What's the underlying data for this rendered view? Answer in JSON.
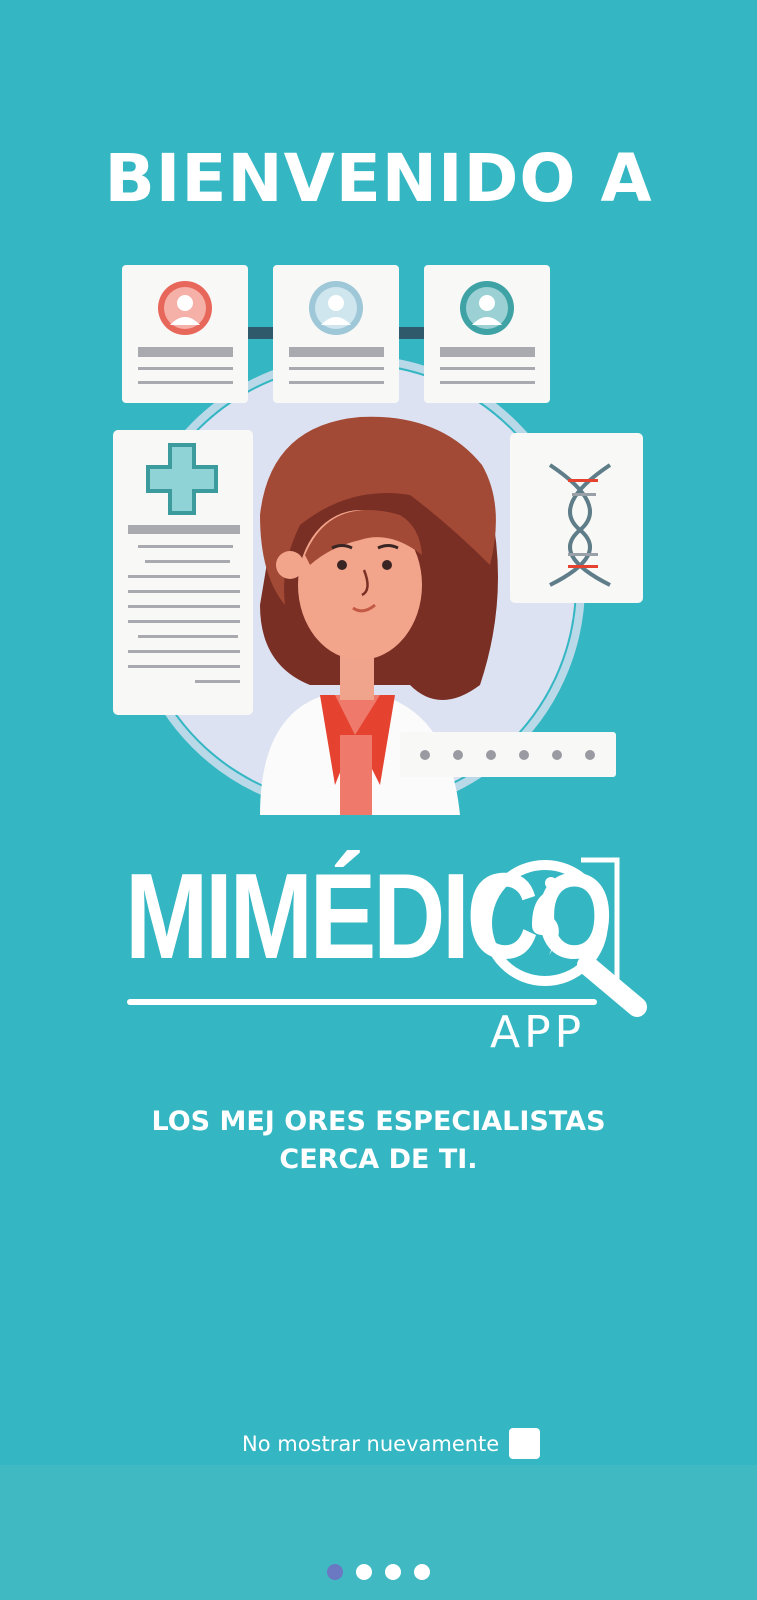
{
  "welcome_title": "BIENVENIDO A",
  "logo": {
    "name": "MIMÉDICO",
    "suffix": "APP"
  },
  "tagline": {
    "line1": "LOS MEJ ORES ESPECIALISTAS",
    "line2": "CERCA DE TI."
  },
  "dont_show_label": "No mostrar nuevamente",
  "dont_show_checked": false,
  "pagination": {
    "total": 4,
    "active_index": 0
  },
  "colors": {
    "background": "#34b6c3",
    "footer": "#40b9c3",
    "active_dot": "#6b78c2",
    "inactive_dot": "#ffffff"
  },
  "illustration_icons": [
    "profile-card-icon",
    "medical-cross-icon",
    "dna-icon",
    "doctor-avatar-icon",
    "password-field-icon"
  ]
}
